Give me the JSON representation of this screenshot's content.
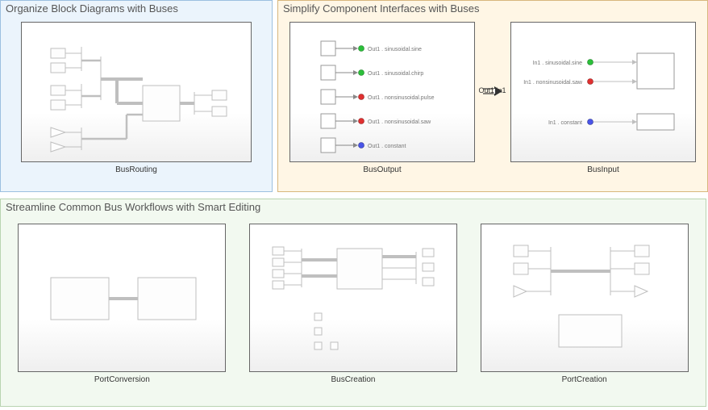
{
  "panels": {
    "organize": {
      "title": "Organize Block Diagrams with Buses",
      "thumb": {
        "label": "BusRouting"
      }
    },
    "simplify": {
      "title": "Simplify Component Interfaces with Buses",
      "out": {
        "label": "BusOutput",
        "port_label": "Out1",
        "signals": [
          {
            "name": "Out1 . sinusoidal.sine",
            "color": "green"
          },
          {
            "name": "Out1 . sinusoidal.chirp",
            "color": "green"
          },
          {
            "name": "Out1 . nonsinusoidal.pulse",
            "color": "red"
          },
          {
            "name": "Out1 . nonsinusoidal.saw",
            "color": "red"
          },
          {
            "name": "Out1 . constant",
            "color": "blue"
          }
        ]
      },
      "in": {
        "label": "BusInput",
        "port_label": "In1",
        "signals_top": [
          {
            "name": "In1 . sinusoidal.sine",
            "color": "green"
          },
          {
            "name": "In1 . nonsinusoidal.saw",
            "color": "red"
          }
        ],
        "signals_bottom": [
          {
            "name": "In1 . constant",
            "color": "blue"
          }
        ]
      }
    },
    "streamline": {
      "title": "Streamline Common Bus Workflows with Smart Editing",
      "thumb1": {
        "label": "PortConversion"
      },
      "thumb2": {
        "label": "BusCreation"
      },
      "thumb3": {
        "label": "PortCreation"
      }
    }
  }
}
